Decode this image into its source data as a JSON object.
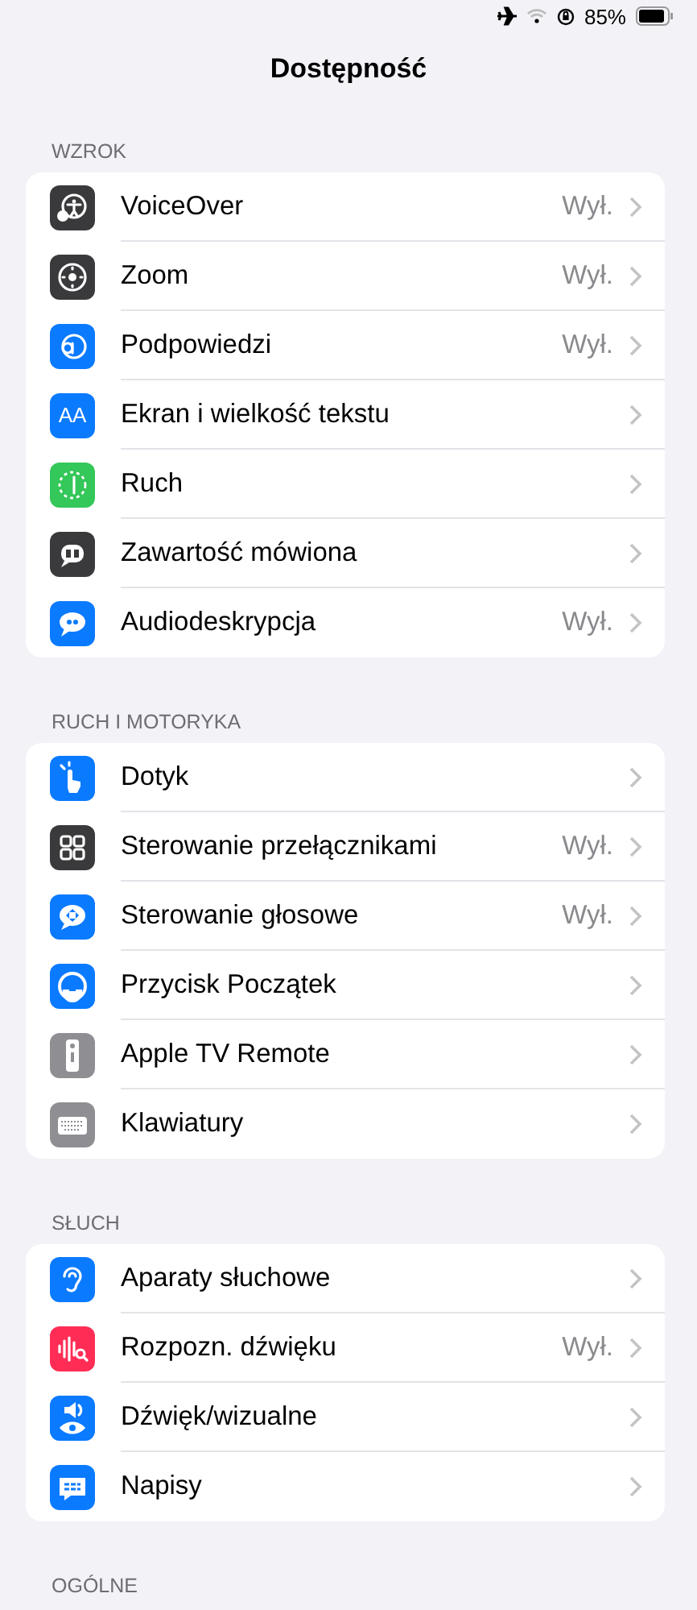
{
  "status_bar": {
    "battery_percent": "85%"
  },
  "title": "Dostępność",
  "sections": [
    {
      "header": "WZROK",
      "rows": [
        {
          "label": "VoiceOver",
          "value": "Wył.",
          "color": "#3a3a3c"
        },
        {
          "label": "Zoom",
          "value": "Wył.",
          "color": "#3a3a3c"
        },
        {
          "label": "Podpowiedzi",
          "value": "Wył.",
          "color": "#0a7aff"
        },
        {
          "label": "Ekran i wielkość tekstu",
          "color": "#0a7aff",
          "icon_text": "AA"
        },
        {
          "label": "Ruch",
          "color": "#34c759"
        },
        {
          "label": "Zawartość mówiona",
          "color": "#3a3a3c"
        },
        {
          "label": "Audiodeskrypcja",
          "value": "Wył.",
          "color": "#0a7aff"
        }
      ]
    },
    {
      "header": "RUCH I MOTORYKA",
      "rows": [
        {
          "label": "Dotyk",
          "color": "#0a7aff"
        },
        {
          "label": "Sterowanie przełącznikami",
          "value": "Wył.",
          "color": "#3a3a3c"
        },
        {
          "label": "Sterowanie głosowe",
          "value": "Wył.",
          "color": "#0a7aff"
        },
        {
          "label": "Przycisk Początek",
          "color": "#0a7aff"
        },
        {
          "label": "Apple TV Remote",
          "color": "#8e8e93"
        },
        {
          "label": "Klawiatury",
          "color": "#8e8e93"
        }
      ]
    },
    {
      "header": "SŁUCH",
      "rows": [
        {
          "label": "Aparaty słuchowe",
          "color": "#0a7aff"
        },
        {
          "label": "Rozpozn. dźwięku",
          "value": "Wył.",
          "color": "#ff2d55"
        },
        {
          "label": "Dźwięk/wizualne",
          "color": "#0a7aff"
        },
        {
          "label": "Napisy",
          "color": "#0a7aff"
        }
      ]
    },
    {
      "header": "OGÓLNE"
    }
  ]
}
